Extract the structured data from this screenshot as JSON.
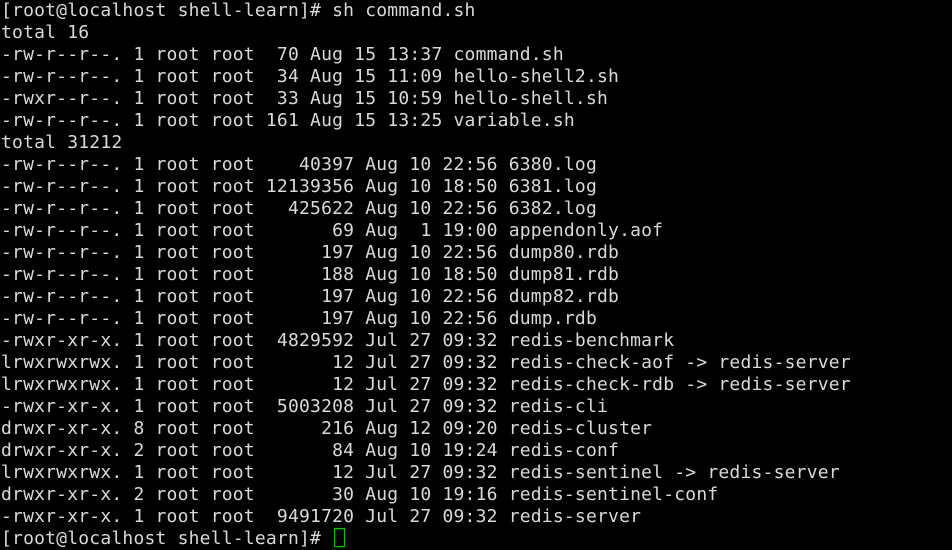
{
  "terminal": {
    "lines": [
      "[root@localhost shell-learn]# sh command.sh",
      "total 16",
      "-rw-r--r--. 1 root root  70 Aug 15 13:37 command.sh",
      "-rw-r--r--. 1 root root  34 Aug 15 11:09 hello-shell2.sh",
      "-rwxr--r--. 1 root root  33 Aug 15 10:59 hello-shell.sh",
      "-rw-r--r--. 1 root root 161 Aug 15 13:25 variable.sh",
      "total 31212",
      "-rw-r--r--. 1 root root    40397 Aug 10 22:56 6380.log",
      "-rw-r--r--. 1 root root 12139356 Aug 10 18:50 6381.log",
      "-rw-r--r--. 1 root root   425622 Aug 10 22:56 6382.log",
      "-rw-r--r--. 1 root root       69 Aug  1 19:00 appendonly.aof",
      "-rw-r--r--. 1 root root      197 Aug 10 22:56 dump80.rdb",
      "-rw-r--r--. 1 root root      188 Aug 10 18:50 dump81.rdb",
      "-rw-r--r--. 1 root root      197 Aug 10 22:56 dump82.rdb",
      "-rw-r--r--. 1 root root      197 Aug 10 22:56 dump.rdb",
      "-rwxr-xr-x. 1 root root  4829592 Jul 27 09:32 redis-benchmark",
      "lrwxrwxrwx. 1 root root       12 Jul 27 09:32 redis-check-aof -> redis-server",
      "lrwxrwxrwx. 1 root root       12 Jul 27 09:32 redis-check-rdb -> redis-server",
      "-rwxr-xr-x. 1 root root  5003208 Jul 27 09:32 redis-cli",
      "drwxr-xr-x. 8 root root      216 Aug 12 09:20 redis-cluster",
      "drwxr-xr-x. 2 root root       84 Aug 10 19:24 redis-conf",
      "lrwxrwxrwx. 1 root root       12 Jul 27 09:32 redis-sentinel -> redis-server",
      "drwxr-xr-x. 2 root root       30 Aug 10 19:16 redis-sentinel-conf",
      "-rwxr-xr-x. 1 root root  9491720 Jul 27 09:32 redis-server"
    ],
    "prompt": "[root@localhost shell-learn]# ",
    "colors": {
      "background": "#000000",
      "foreground": "#d9d9d9",
      "cursor": "#00c800"
    }
  }
}
